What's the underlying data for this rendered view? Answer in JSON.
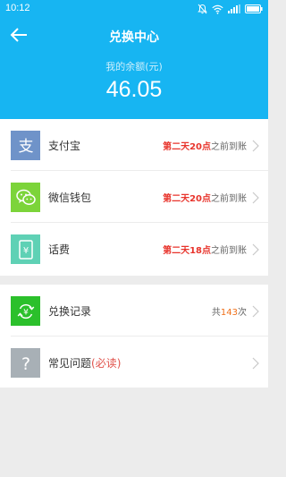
{
  "status_bar": {
    "time": "10:12",
    "icons": [
      "alarm-off-icon",
      "wifi-icon",
      "signal-icon",
      "battery-icon"
    ]
  },
  "header": {
    "title": "兑换中心",
    "back_icon": "arrow-left-icon",
    "balance_label": "我的余额(元)",
    "balance_value": "46.05",
    "background_color": "#17b5f2"
  },
  "payout_methods": [
    {
      "label": "支付宝",
      "icon": "alipay-icon",
      "icon_color": "#6f93c9",
      "arrival_highlight": "第二天20点",
      "arrival_suffix": "之前到账"
    },
    {
      "label": "微信钱包",
      "icon": "wechat-icon",
      "icon_color": "#7cd43a",
      "arrival_highlight": "第二天20点",
      "arrival_suffix": "之前到账"
    },
    {
      "label": "话费",
      "icon": "phone-bill-icon",
      "icon_color": "#5fd1b5",
      "arrival_highlight": "第二天18点",
      "arrival_suffix": "之前到账"
    }
  ],
  "records": {
    "label": "兑换记录",
    "icon": "exchange-record-icon",
    "icon_color": "#2bc02b",
    "count_prefix": "共",
    "count": "143",
    "count_suffix": "次"
  },
  "faq": {
    "label": "常见问题",
    "label_accent": "(必读)",
    "icon": "question-icon",
    "icon_color": "#a8b0b6"
  },
  "colors": {
    "highlight_red": "#e8342c",
    "count_orange": "#f0701a",
    "page_background": "#ececec"
  }
}
